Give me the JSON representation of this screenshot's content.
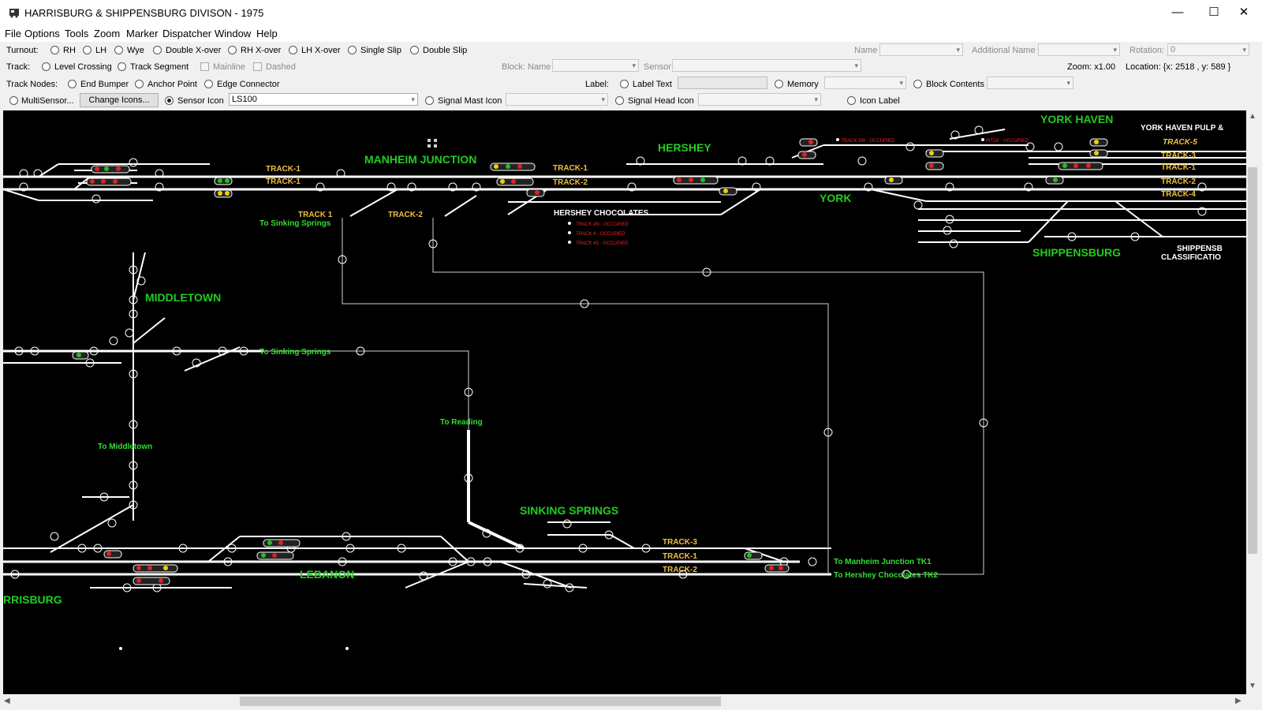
{
  "window": {
    "title": "HARRISBURG & SHIPPENSBURG DIVISON - 1975",
    "minimize": "—",
    "maximize": "☐",
    "close": "✕"
  },
  "menu": [
    "File",
    "Options",
    "Tools",
    "Zoom",
    "Marker",
    "Dispatcher",
    "Window",
    "Help"
  ],
  "toolbar": {
    "turnout_label": "Turnout:",
    "turnout_options": [
      "RH",
      "LH",
      "Wye",
      "Double X-over",
      "RH X-over",
      "LH X-over",
      "Single Slip",
      "Double Slip"
    ],
    "name_label": "Name",
    "additional_name_label": "Additional Name",
    "rotation_label": "Rotation:",
    "rotation_value": "0",
    "track_label": "Track:",
    "level_crossing": "Level Crossing",
    "track_segment": "Track Segment",
    "mainline": "Mainline",
    "dashed": "Dashed",
    "block_name_label": "Block: Name",
    "sensor_label": "Sensor",
    "zoom_text": "Zoom: x1.00",
    "location_text": "Location: {x: 2518 , y: 589  }",
    "track_nodes_label": "Track Nodes:",
    "end_bumper": "End Bumper",
    "anchor_point": "Anchor Point",
    "edge_connector": "Edge Connector",
    "label_label": "Label:",
    "label_text": "Label Text",
    "memory": "Memory",
    "block_contents": "Block Contents",
    "multisensor": "MultiSensor...",
    "change_icons": "Change Icons...",
    "sensor_icon": "Sensor Icon",
    "sensor_icon_value": "LS100",
    "signal_mast_icon": "Signal Mast Icon",
    "signal_head_icon": "Signal Head Icon",
    "icon_label": "Icon Label"
  },
  "layout": {
    "station_labels": [
      "YORK HAVEN",
      "MANHEIM JUNCTION",
      "HERSHEY",
      "YORK",
      "SHIPPENSBURG",
      "MIDDLETOWN",
      "SINKING SPRINGS",
      "LEBANON",
      "RRISBURG"
    ],
    "track_labels": [
      "TRACK-1",
      "TRACK-1",
      "TRACK-1",
      "TRACK-2",
      "TRACK 1",
      "TRACK-2",
      "TRACK-5",
      "TRACK-3",
      "TRACK-1",
      "TRACK-2",
      "TRACK-4",
      "TRACK-3",
      "TRACK-1",
      "TRACK-2"
    ],
    "white_labels": [
      "HERSHEY CHOCOLATES",
      "YORK HAVEN PULP &",
      "SHIPPENSB",
      "CLASSIFICATIO"
    ],
    "connector_labels": [
      "To Sinking Springs",
      "To Sinking Springs",
      "To Reading",
      "To Middletown",
      "To Manheim Junction TK1",
      "To Hershey Chocolates TK2"
    ],
    "occupied_labels": [
      "TRACK 5W - OCCUPIED",
      "PITLK - OCCUPIED",
      "TRACK 4N - OCCUPIED",
      "TRACK 4 - OCCUPIED",
      "TRACK 4S - OCCUPIED"
    ],
    "colors": {
      "background": "#000000",
      "track": "#ffffff",
      "station": "#22cc22",
      "track_label": "#f0c040",
      "connector": "#33dd33",
      "occupied": "#ff2020"
    }
  }
}
